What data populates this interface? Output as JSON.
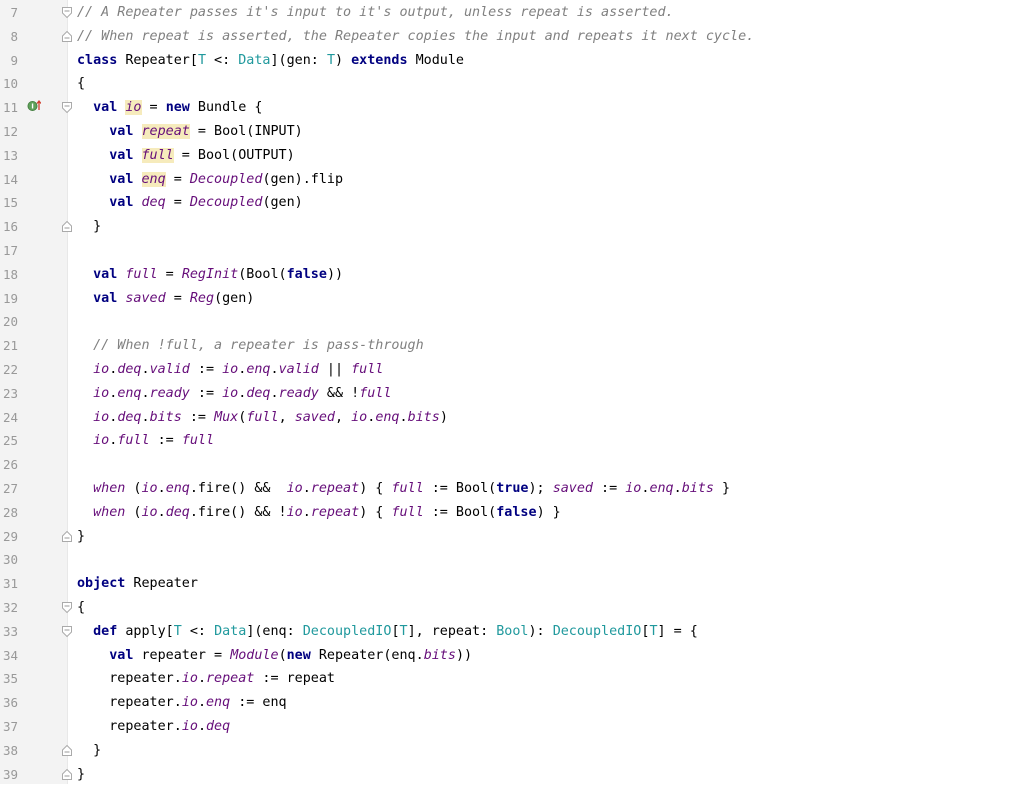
{
  "editor": {
    "line_numbers": [
      "7",
      "8",
      "9",
      "10",
      "11",
      "12",
      "13",
      "14",
      "15",
      "16",
      "17",
      "18",
      "19",
      "20",
      "21",
      "22",
      "23",
      "24",
      "25",
      "26",
      "27",
      "28",
      "29",
      "30",
      "31",
      "32",
      "33",
      "34",
      "35",
      "36",
      "37",
      "38",
      "39"
    ],
    "colors": {
      "keyword": "#000080",
      "comment": "#808080",
      "type": "#20999d",
      "field": "#660e7a",
      "usage_highlight": "#f6ebbc",
      "gutter": "#f3f3f3",
      "line_number": "#999999"
    },
    "lines": [
      [
        {
          "c": "cm",
          "t": "// A Repeater passes it's input to it's output, unless repeat is asserted."
        }
      ],
      [
        {
          "c": "cm",
          "t": "// When repeat is asserted, the Repeater copies the input and repeats it next cycle."
        }
      ],
      [
        {
          "c": "kw",
          "t": "class"
        },
        {
          "c": "",
          "t": " Repeater["
        },
        {
          "c": "ty",
          "t": "T"
        },
        {
          "c": "",
          "t": " <: "
        },
        {
          "c": "ty",
          "t": "Data"
        },
        {
          "c": "",
          "t": "](gen: "
        },
        {
          "c": "ty",
          "t": "T"
        },
        {
          "c": "",
          "t": ") "
        },
        {
          "c": "kw",
          "t": "extends"
        },
        {
          "c": "",
          "t": " Module"
        }
      ],
      [
        {
          "c": "",
          "t": "{"
        }
      ],
      [
        {
          "c": "",
          "t": "  "
        },
        {
          "c": "kw",
          "t": "val"
        },
        {
          "c": "",
          "t": " "
        },
        {
          "c": "fld hl",
          "t": "io"
        },
        {
          "c": "",
          "t": " = "
        },
        {
          "c": "kw",
          "t": "new"
        },
        {
          "c": "",
          "t": " Bundle {"
        }
      ],
      [
        {
          "c": "",
          "t": "    "
        },
        {
          "c": "kw",
          "t": "val"
        },
        {
          "c": "",
          "t": " "
        },
        {
          "c": "fld hl",
          "t": "repeat"
        },
        {
          "c": "",
          "t": " = Bool(INPUT)"
        }
      ],
      [
        {
          "c": "",
          "t": "    "
        },
        {
          "c": "kw",
          "t": "val"
        },
        {
          "c": "",
          "t": " "
        },
        {
          "c": "fld hl",
          "t": "full"
        },
        {
          "c": "",
          "t": " = Bool(OUTPUT)"
        }
      ],
      [
        {
          "c": "",
          "t": "    "
        },
        {
          "c": "kw",
          "t": "val"
        },
        {
          "c": "",
          "t": " "
        },
        {
          "c": "fld hl",
          "t": "enq"
        },
        {
          "c": "",
          "t": " = "
        },
        {
          "c": "fn",
          "t": "Decoupled"
        },
        {
          "c": "",
          "t": "(gen).flip"
        }
      ],
      [
        {
          "c": "",
          "t": "    "
        },
        {
          "c": "kw",
          "t": "val"
        },
        {
          "c": "",
          "t": " "
        },
        {
          "c": "fld",
          "t": "deq"
        },
        {
          "c": "",
          "t": " = "
        },
        {
          "c": "fn",
          "t": "Decoupled"
        },
        {
          "c": "",
          "t": "(gen)"
        }
      ],
      [
        {
          "c": "",
          "t": "  }"
        }
      ],
      [
        {
          "c": "",
          "t": ""
        }
      ],
      [
        {
          "c": "",
          "t": "  "
        },
        {
          "c": "kw",
          "t": "val"
        },
        {
          "c": "",
          "t": " "
        },
        {
          "c": "fld",
          "t": "full"
        },
        {
          "c": "",
          "t": " = "
        },
        {
          "c": "fn",
          "t": "RegInit"
        },
        {
          "c": "",
          "t": "(Bool("
        },
        {
          "c": "kw",
          "t": "false"
        },
        {
          "c": "",
          "t": "))"
        }
      ],
      [
        {
          "c": "",
          "t": "  "
        },
        {
          "c": "kw",
          "t": "val"
        },
        {
          "c": "",
          "t": " "
        },
        {
          "c": "fld",
          "t": "saved"
        },
        {
          "c": "",
          "t": " = "
        },
        {
          "c": "fn",
          "t": "Reg"
        },
        {
          "c": "",
          "t": "(gen)"
        }
      ],
      [
        {
          "c": "",
          "t": ""
        }
      ],
      [
        {
          "c": "",
          "t": "  "
        },
        {
          "c": "cm",
          "t": "// When !full, a repeater is pass-through"
        }
      ],
      [
        {
          "c": "",
          "t": "  "
        },
        {
          "c": "fld",
          "t": "io"
        },
        {
          "c": "",
          "t": "."
        },
        {
          "c": "fld",
          "t": "deq"
        },
        {
          "c": "",
          "t": "."
        },
        {
          "c": "fld",
          "t": "valid"
        },
        {
          "c": "",
          "t": " := "
        },
        {
          "c": "fld",
          "t": "io"
        },
        {
          "c": "",
          "t": "."
        },
        {
          "c": "fld",
          "t": "enq"
        },
        {
          "c": "",
          "t": "."
        },
        {
          "c": "fld",
          "t": "valid"
        },
        {
          "c": "",
          "t": " || "
        },
        {
          "c": "fld",
          "t": "full"
        }
      ],
      [
        {
          "c": "",
          "t": "  "
        },
        {
          "c": "fld",
          "t": "io"
        },
        {
          "c": "",
          "t": "."
        },
        {
          "c": "fld",
          "t": "enq"
        },
        {
          "c": "",
          "t": "."
        },
        {
          "c": "fld",
          "t": "ready"
        },
        {
          "c": "",
          "t": " := "
        },
        {
          "c": "fld",
          "t": "io"
        },
        {
          "c": "",
          "t": "."
        },
        {
          "c": "fld",
          "t": "deq"
        },
        {
          "c": "",
          "t": "."
        },
        {
          "c": "fld",
          "t": "ready"
        },
        {
          "c": "",
          "t": " && !"
        },
        {
          "c": "fld",
          "t": "full"
        }
      ],
      [
        {
          "c": "",
          "t": "  "
        },
        {
          "c": "fld",
          "t": "io"
        },
        {
          "c": "",
          "t": "."
        },
        {
          "c": "fld",
          "t": "deq"
        },
        {
          "c": "",
          "t": "."
        },
        {
          "c": "fld",
          "t": "bits"
        },
        {
          "c": "",
          "t": " := "
        },
        {
          "c": "fn",
          "t": "Mux"
        },
        {
          "c": "",
          "t": "("
        },
        {
          "c": "fld",
          "t": "full"
        },
        {
          "c": "",
          "t": ", "
        },
        {
          "c": "fld",
          "t": "saved"
        },
        {
          "c": "",
          "t": ", "
        },
        {
          "c": "fld",
          "t": "io"
        },
        {
          "c": "",
          "t": "."
        },
        {
          "c": "fld",
          "t": "enq"
        },
        {
          "c": "",
          "t": "."
        },
        {
          "c": "fld",
          "t": "bits"
        },
        {
          "c": "",
          "t": ")"
        }
      ],
      [
        {
          "c": "",
          "t": "  "
        },
        {
          "c": "fld",
          "t": "io"
        },
        {
          "c": "",
          "t": "."
        },
        {
          "c": "fld",
          "t": "full"
        },
        {
          "c": "",
          "t": " := "
        },
        {
          "c": "fld",
          "t": "full"
        }
      ],
      [
        {
          "c": "",
          "t": ""
        }
      ],
      [
        {
          "c": "",
          "t": "  "
        },
        {
          "c": "fn",
          "t": "when"
        },
        {
          "c": "",
          "t": " ("
        },
        {
          "c": "fld",
          "t": "io"
        },
        {
          "c": "",
          "t": "."
        },
        {
          "c": "fld",
          "t": "enq"
        },
        {
          "c": "",
          "t": ".fire() &&  "
        },
        {
          "c": "fld",
          "t": "io"
        },
        {
          "c": "",
          "t": "."
        },
        {
          "c": "fld",
          "t": "repeat"
        },
        {
          "c": "",
          "t": ") { "
        },
        {
          "c": "fld",
          "t": "full"
        },
        {
          "c": "",
          "t": " := Bool("
        },
        {
          "c": "kw",
          "t": "true"
        },
        {
          "c": "",
          "t": "); "
        },
        {
          "c": "fld",
          "t": "saved"
        },
        {
          "c": "",
          "t": " := "
        },
        {
          "c": "fld",
          "t": "io"
        },
        {
          "c": "",
          "t": "."
        },
        {
          "c": "fld",
          "t": "enq"
        },
        {
          "c": "",
          "t": "."
        },
        {
          "c": "fld",
          "t": "bits"
        },
        {
          "c": "",
          "t": " }"
        }
      ],
      [
        {
          "c": "",
          "t": "  "
        },
        {
          "c": "fn",
          "t": "when"
        },
        {
          "c": "",
          "t": " ("
        },
        {
          "c": "fld",
          "t": "io"
        },
        {
          "c": "",
          "t": "."
        },
        {
          "c": "fld",
          "t": "deq"
        },
        {
          "c": "",
          "t": ".fire() && !"
        },
        {
          "c": "fld",
          "t": "io"
        },
        {
          "c": "",
          "t": "."
        },
        {
          "c": "fld",
          "t": "repeat"
        },
        {
          "c": "",
          "t": ") { "
        },
        {
          "c": "fld",
          "t": "full"
        },
        {
          "c": "",
          "t": " := Bool("
        },
        {
          "c": "kw",
          "t": "false"
        },
        {
          "c": "",
          "t": ") }"
        }
      ],
      [
        {
          "c": "",
          "t": "}"
        }
      ],
      [
        {
          "c": "",
          "t": ""
        }
      ],
      [
        {
          "c": "kw",
          "t": "object"
        },
        {
          "c": "",
          "t": " Repeater"
        }
      ],
      [
        {
          "c": "",
          "t": "{"
        }
      ],
      [
        {
          "c": "",
          "t": "  "
        },
        {
          "c": "kw",
          "t": "def"
        },
        {
          "c": "",
          "t": " apply["
        },
        {
          "c": "ty",
          "t": "T"
        },
        {
          "c": "",
          "t": " <: "
        },
        {
          "c": "ty",
          "t": "Data"
        },
        {
          "c": "",
          "t": "](enq: "
        },
        {
          "c": "ty",
          "t": "DecoupledIO"
        },
        {
          "c": "",
          "t": "["
        },
        {
          "c": "ty",
          "t": "T"
        },
        {
          "c": "",
          "t": "], repeat: "
        },
        {
          "c": "ty",
          "t": "Bool"
        },
        {
          "c": "",
          "t": "): "
        },
        {
          "c": "ty",
          "t": "DecoupledIO"
        },
        {
          "c": "",
          "t": "["
        },
        {
          "c": "ty",
          "t": "T"
        },
        {
          "c": "",
          "t": "] = {"
        }
      ],
      [
        {
          "c": "",
          "t": "    "
        },
        {
          "c": "kw",
          "t": "val"
        },
        {
          "c": "",
          "t": " repeater = "
        },
        {
          "c": "fn",
          "t": "Module"
        },
        {
          "c": "",
          "t": "("
        },
        {
          "c": "kw",
          "t": "new"
        },
        {
          "c": "",
          "t": " Repeater(enq."
        },
        {
          "c": "fld",
          "t": "bits"
        },
        {
          "c": "",
          "t": "))"
        }
      ],
      [
        {
          "c": "",
          "t": "    repeater."
        },
        {
          "c": "fld",
          "t": "io"
        },
        {
          "c": "",
          "t": "."
        },
        {
          "c": "fld",
          "t": "repeat"
        },
        {
          "c": "",
          "t": " := repeat"
        }
      ],
      [
        {
          "c": "",
          "t": "    repeater."
        },
        {
          "c": "fld",
          "t": "io"
        },
        {
          "c": "",
          "t": "."
        },
        {
          "c": "fld",
          "t": "enq"
        },
        {
          "c": "",
          "t": " := enq"
        }
      ],
      [
        {
          "c": "",
          "t": "    repeater."
        },
        {
          "c": "fld",
          "t": "io"
        },
        {
          "c": "",
          "t": "."
        },
        {
          "c": "fld",
          "t": "deq"
        }
      ],
      [
        {
          "c": "",
          "t": "  }"
        }
      ],
      [
        {
          "c": "",
          "t": "}"
        }
      ]
    ],
    "fold_markers": [
      {
        "line_index": 0,
        "kind": "open"
      },
      {
        "line_index": 1,
        "kind": "close"
      },
      {
        "line_index": 4,
        "kind": "open"
      },
      {
        "line_index": 9,
        "kind": "close"
      },
      {
        "line_index": 22,
        "kind": "close"
      },
      {
        "line_index": 25,
        "kind": "open"
      },
      {
        "line_index": 26,
        "kind": "open"
      },
      {
        "line_index": 31,
        "kind": "close"
      },
      {
        "line_index": 32,
        "kind": "close"
      }
    ],
    "gutter_icons": [
      {
        "line_index": 4,
        "icon": "implements-method-icon"
      }
    ]
  }
}
